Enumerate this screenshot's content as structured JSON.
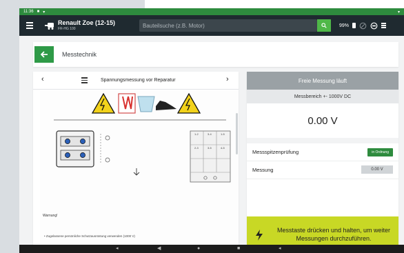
{
  "status_bar": {
    "time": "11:36",
    "right": "▾"
  },
  "app_bar": {
    "vehicle_name": "Renault Zoe (12-15)",
    "vehicle_plate": "FR-HG 100",
    "search_placeholder": "Bauteilsuche (z.B. Motor)",
    "battery_percent": "99%"
  },
  "header": {
    "title": "Messtechnik"
  },
  "document": {
    "title": "Spannungsmessung vor Reparatur",
    "warning_heading": "Warnung!",
    "warning_item": "Zugelassene persönliche Schutzausrüstung verwenden (1000 V)",
    "table_labels": [
      "1-2",
      "3-4",
      "1-5",
      "2-3",
      "3-5",
      "4-5"
    ]
  },
  "measurement": {
    "status": "Freie Messung läuft",
    "range": "Messbereich +- 1000V DC",
    "value": "0.00 V",
    "probe_check_label": "Messspitzenprüfung",
    "probe_check_status": "in Ordnung",
    "measurement_label": "Messung",
    "measurement_value": "0.00 V",
    "hint": "Messtaste drücken und halten, um weiter Messungen durchzuführen."
  },
  "colors": {
    "accent_green": "#2e8b3e",
    "hint_yellow": "#c8d825",
    "appbar": "#1f2a30"
  }
}
